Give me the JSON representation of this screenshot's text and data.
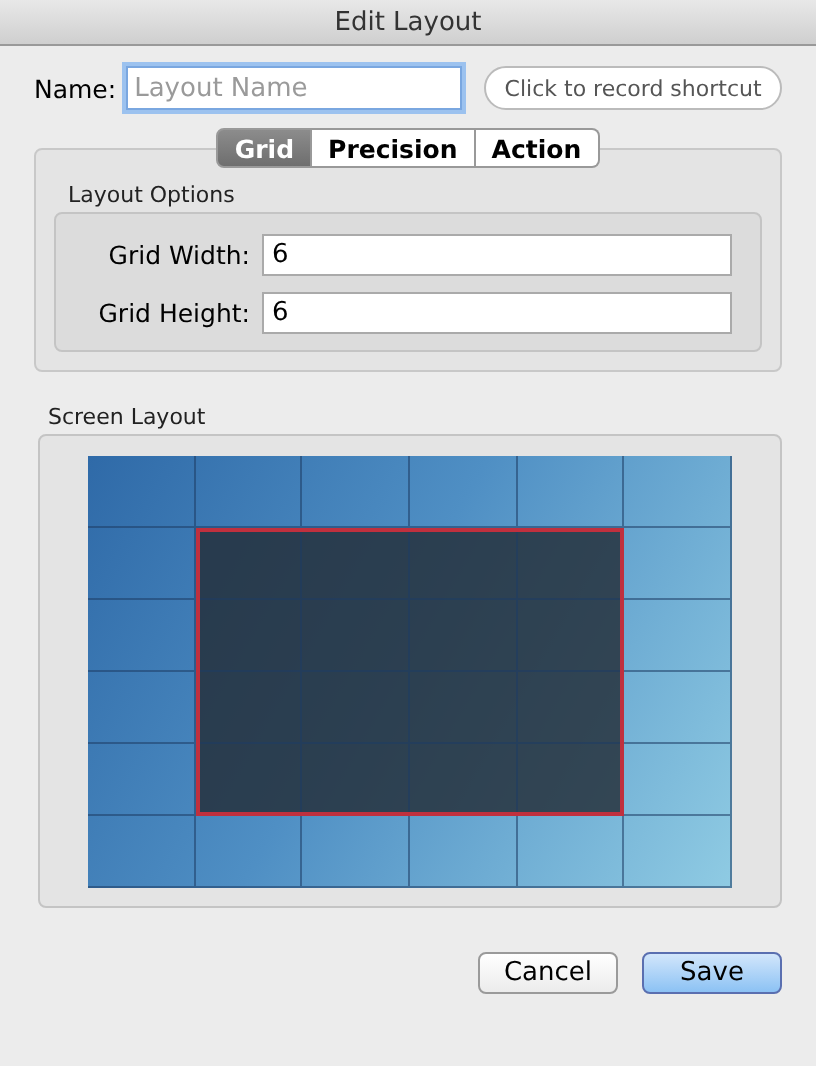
{
  "window": {
    "title": "Edit Layout"
  },
  "name_field": {
    "label": "Name:",
    "placeholder": "Layout Name"
  },
  "shortcut_button": {
    "label": "Click to record shortcut"
  },
  "tabs": [
    {
      "label": "Grid",
      "selected": true
    },
    {
      "label": "Precision",
      "selected": false
    },
    {
      "label": "Action",
      "selected": false
    }
  ],
  "layout_options": {
    "title": "Layout Options",
    "fields": [
      {
        "label": "Grid Width:",
        "value": "6"
      },
      {
        "label": "Grid Height:",
        "value": "6"
      }
    ]
  },
  "screen_layout": {
    "title": "Screen Layout",
    "rows": [
      [
        {
          "selected": false
        },
        {
          "selected": false
        },
        {
          "selected": false
        },
        {
          "selected": false
        },
        {
          "selected": false
        },
        {
          "selected": false
        }
      ],
      [
        {
          "selected": false
        },
        {
          "selected": true
        },
        {
          "selected": true
        },
        {
          "selected": true
        },
        {
          "selected": true
        },
        {
          "selected": false
        }
      ],
      [
        {
          "selected": false
        },
        {
          "selected": true
        },
        {
          "selected": true
        },
        {
          "selected": true
        },
        {
          "selected": true
        },
        {
          "selected": false
        }
      ],
      [
        {
          "selected": false
        },
        {
          "selected": true
        },
        {
          "selected": true
        },
        {
          "selected": true
        },
        {
          "selected": true
        },
        {
          "selected": false
        }
      ],
      [
        {
          "selected": false
        },
        {
          "selected": true
        },
        {
          "selected": true
        },
        {
          "selected": true
        },
        {
          "selected": true
        },
        {
          "selected": false
        }
      ],
      [
        {
          "selected": false
        },
        {
          "selected": false
        },
        {
          "selected": false
        },
        {
          "selected": false
        },
        {
          "selected": false
        },
        {
          "selected": false
        }
      ]
    ]
  },
  "buttons": [
    {
      "label": "Cancel",
      "kind": "normal"
    },
    {
      "label": "Save",
      "kind": "default"
    }
  ]
}
